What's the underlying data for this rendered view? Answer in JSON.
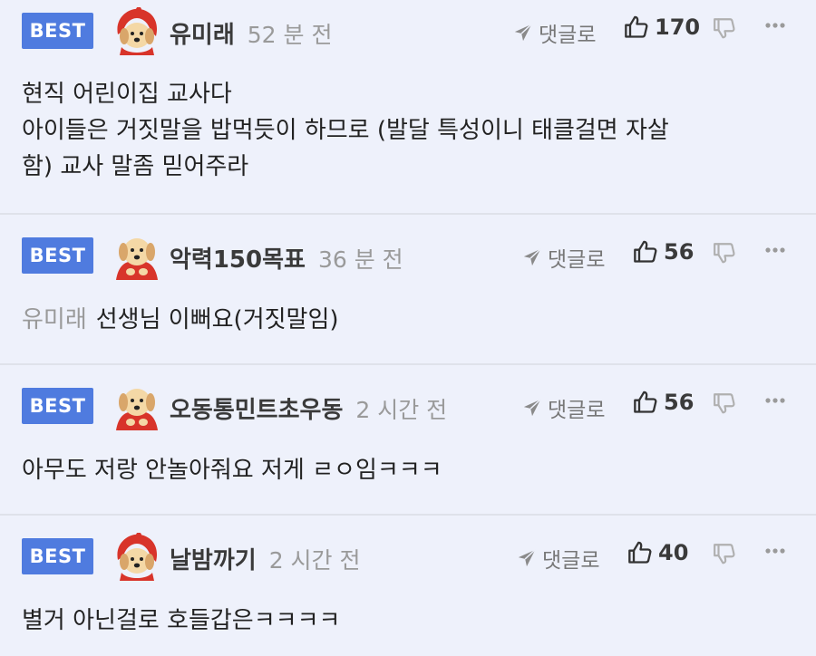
{
  "comments": [
    {
      "badge": "BEST",
      "author": "유미래",
      "time": "52 분 전",
      "reply_label": "댓글로",
      "likes": "170",
      "mention": "",
      "lines": [
        "현직 어린이집 교사다",
        "아이들은 거짓말을 밥먹듯이 하므로 (발달 특성이니 태클걸면 자살",
        "함) 교사 말좀 믿어주라"
      ],
      "avatar": "puppy-red-hood-icon"
    },
    {
      "badge": "BEST",
      "author": "악력150목표",
      "time": "36 분 전",
      "reply_label": "댓글로",
      "likes": "56",
      "mention": "유미래",
      "lines": [
        "선생님 이뻐요(거짓말임)"
      ],
      "avatar": "puppy-red-cape-icon"
    },
    {
      "badge": "BEST",
      "author": "오동통민트초우동",
      "time": "2 시간 전",
      "reply_label": "댓글로",
      "likes": "56",
      "mention": "",
      "lines": [
        "아무도 저랑 안놀아줘요 저게 ㄹㅇ임ㅋㅋㅋ"
      ],
      "avatar": "puppy-red-cape-icon"
    },
    {
      "badge": "BEST",
      "author": "날밤까기",
      "time": "2 시간 전",
      "reply_label": "댓글로",
      "likes": "40",
      "mention": "",
      "lines": [
        "별거 아닌걸로 호들갑은ㅋㅋㅋㅋ"
      ],
      "avatar": "puppy-red-hood-icon"
    }
  ],
  "colors": {
    "background": "#eef1fb",
    "badge": "#4f7bdf",
    "divider": "#dfe2ea",
    "meta_text": "#9a9a9a"
  }
}
